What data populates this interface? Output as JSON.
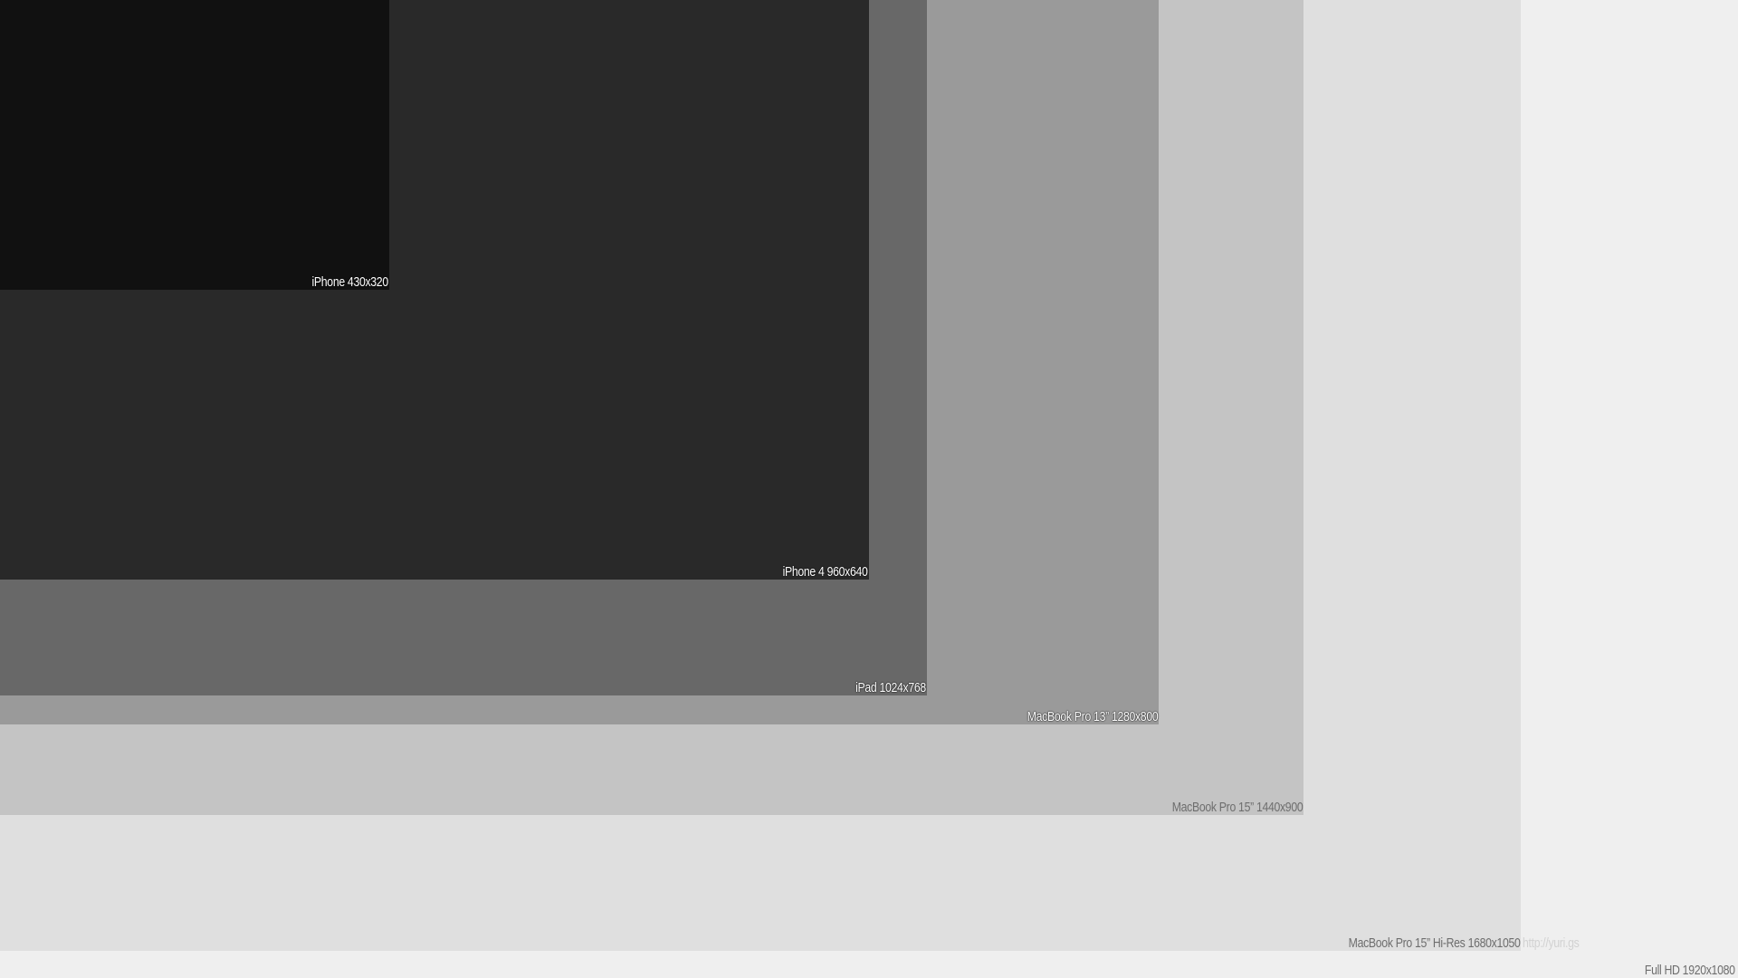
{
  "background_color": "#efefef",
  "rectangles": [
    {
      "id": "macbook-pro-15-hi-res",
      "label": "MacBook Pro 15” Hi-Res 1680x1050",
      "color": "#dfdfdf"
    },
    {
      "id": "macbook-pro-15",
      "label": "MacBook Pro 15” 1440x900",
      "color": "#c4c4c4"
    },
    {
      "id": "macbook-pro-13",
      "label": "MacBook Pro 13” 1280x800",
      "color": "#9a9a9a"
    },
    {
      "id": "ipad",
      "label": "iPad 1024x768",
      "color": "#686868"
    },
    {
      "id": "iphone-4",
      "label": "iPhone 4 960x640",
      "color": "#292929"
    },
    {
      "id": "iphone",
      "label": "iPhone 430x320",
      "color": "#111111"
    }
  ],
  "full_hd_label": "Full HD 1920x1080",
  "url_label": "http://yuri.gs"
}
